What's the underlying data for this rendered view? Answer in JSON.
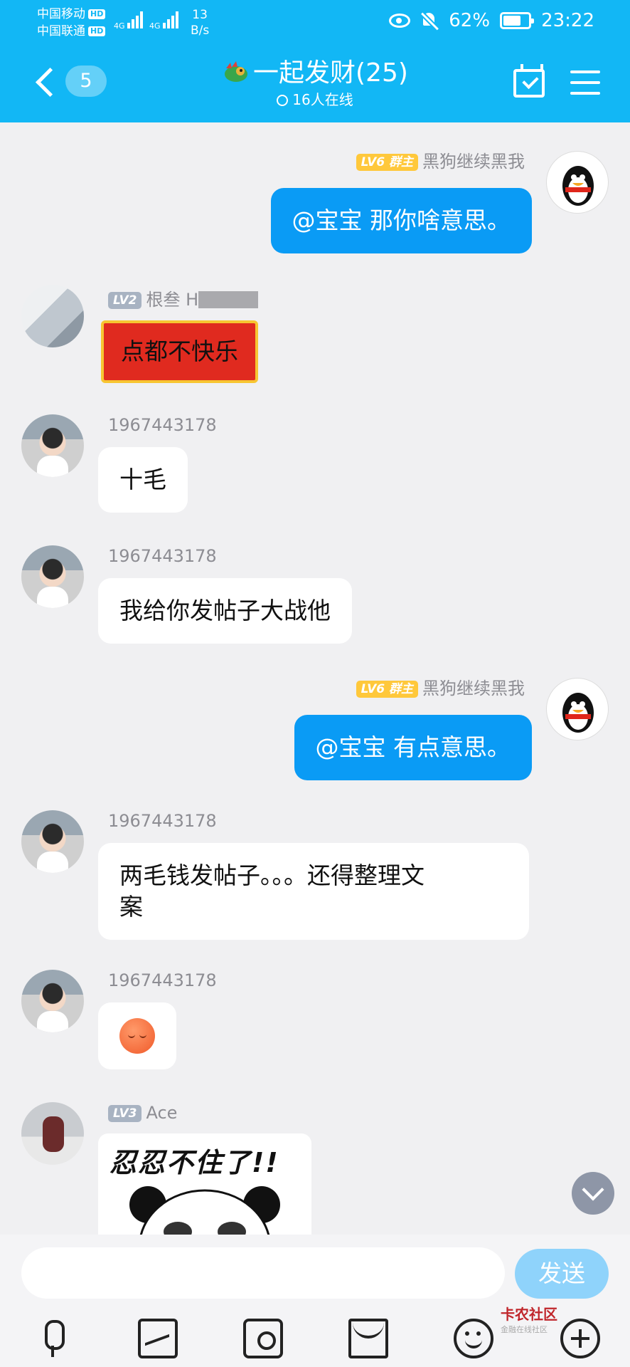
{
  "status": {
    "carrier1": "中国移动",
    "carrier2": "中国联通",
    "hd": "HD",
    "net": "4G",
    "speed_value": "13",
    "speed_unit": "B/s",
    "battery": "62%",
    "time": "23:22"
  },
  "header": {
    "unread_count": "5",
    "title": "一起发财(25)",
    "online": "16人在线"
  },
  "messages": [
    {
      "side": "right",
      "level": "LV6",
      "role": "群主",
      "name": "黑狗继续黑我",
      "text": "@宝宝 那你啥意思。"
    },
    {
      "side": "left",
      "level": "LV2",
      "name": "根叁 H",
      "text": "点都不快乐",
      "style": "red-banner"
    },
    {
      "side": "left",
      "name": "1967443178",
      "text": "十毛"
    },
    {
      "side": "left",
      "name": "1967443178",
      "text": "我给你发帖子大战他"
    },
    {
      "side": "right",
      "level": "LV6",
      "role": "群主",
      "name": "黑狗继续黑我",
      "text": "@宝宝 有点意思。"
    },
    {
      "side": "left",
      "name": "1967443178",
      "text_line1": "两毛钱发帖子。。。还得整理文",
      "text_line2": "案"
    },
    {
      "side": "left",
      "name": "1967443178",
      "emoji": "sleepy-face"
    },
    {
      "side": "left",
      "level": "LV3",
      "name": "Ace",
      "sticker_text": "忍忍不住了!!"
    }
  ],
  "composer": {
    "placeholder": "",
    "send_label": "发送"
  },
  "watermark": {
    "line1": "卡农社区",
    "line2": "金融在线社区"
  }
}
